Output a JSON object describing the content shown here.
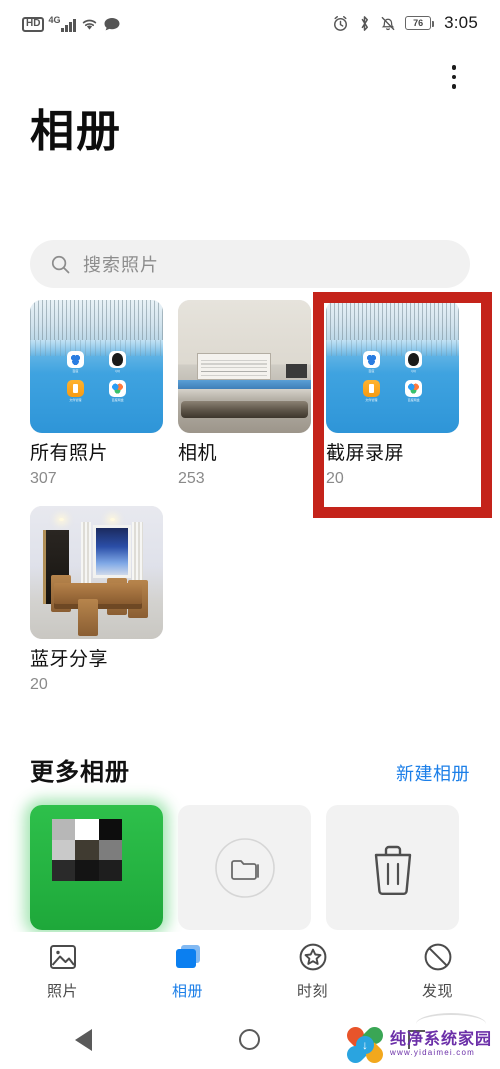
{
  "status_bar": {
    "hd_label": "HD",
    "network_label": "4G",
    "icons_left": [
      "hd-icon",
      "signal-icon",
      "wifi-icon",
      "message-icon"
    ],
    "icons_right": [
      "alarm-icon",
      "bluetooth-icon",
      "mute-icon"
    ],
    "battery_level": "76",
    "time": "3:05"
  },
  "header": {
    "title": "相册",
    "overflow_menu": "more-options-icon"
  },
  "search": {
    "placeholder": "搜索照片",
    "icon": "search-icon"
  },
  "albums": [
    {
      "name": "所有照片",
      "count": "307",
      "thumb": "homescreen-screenshot"
    },
    {
      "name": "相机",
      "count": "253",
      "thumb": "machine-photo"
    },
    {
      "name": "截屏录屏",
      "count": "20",
      "thumb": "homescreen-screenshot",
      "highlighted": true
    },
    {
      "name": "蓝牙分享",
      "count": "20",
      "thumb": "dining-room-photo"
    }
  ],
  "more_albums": {
    "title": "更多相册",
    "new_album_label": "新建相册",
    "tiles": [
      {
        "name": "wechat-album",
        "icon": "pixelated-thumbnail"
      },
      {
        "name": "other-albums",
        "icon": "folder-icon"
      },
      {
        "name": "recently-deleted",
        "icon": "trash-icon"
      }
    ]
  },
  "bottom_nav": [
    {
      "label": "照片",
      "icon": "photo-icon",
      "active": false
    },
    {
      "label": "相册",
      "icon": "albums-icon",
      "active": true
    },
    {
      "label": "时刻",
      "icon": "moments-star-icon",
      "active": false
    },
    {
      "label": "发现",
      "icon": "discover-icon",
      "active": false
    }
  ],
  "system_nav": [
    {
      "name": "back-button",
      "icon": "triangle-back-icon"
    },
    {
      "name": "home-button",
      "icon": "circle-home-icon"
    },
    {
      "name": "recents-button",
      "icon": "bracket-recents-icon"
    }
  ],
  "annotation": {
    "type": "red-rectangle-highlight",
    "target": "截屏录屏"
  },
  "watermark": {
    "brand": "纯净系统家园",
    "url": "www.yidaimei.com"
  },
  "colors": {
    "accent_blue": "#1c7fe8",
    "highlight_red": "#c4231a",
    "watermark_purple": "#6b2fa8",
    "muted_text": "#8a8a8a"
  }
}
